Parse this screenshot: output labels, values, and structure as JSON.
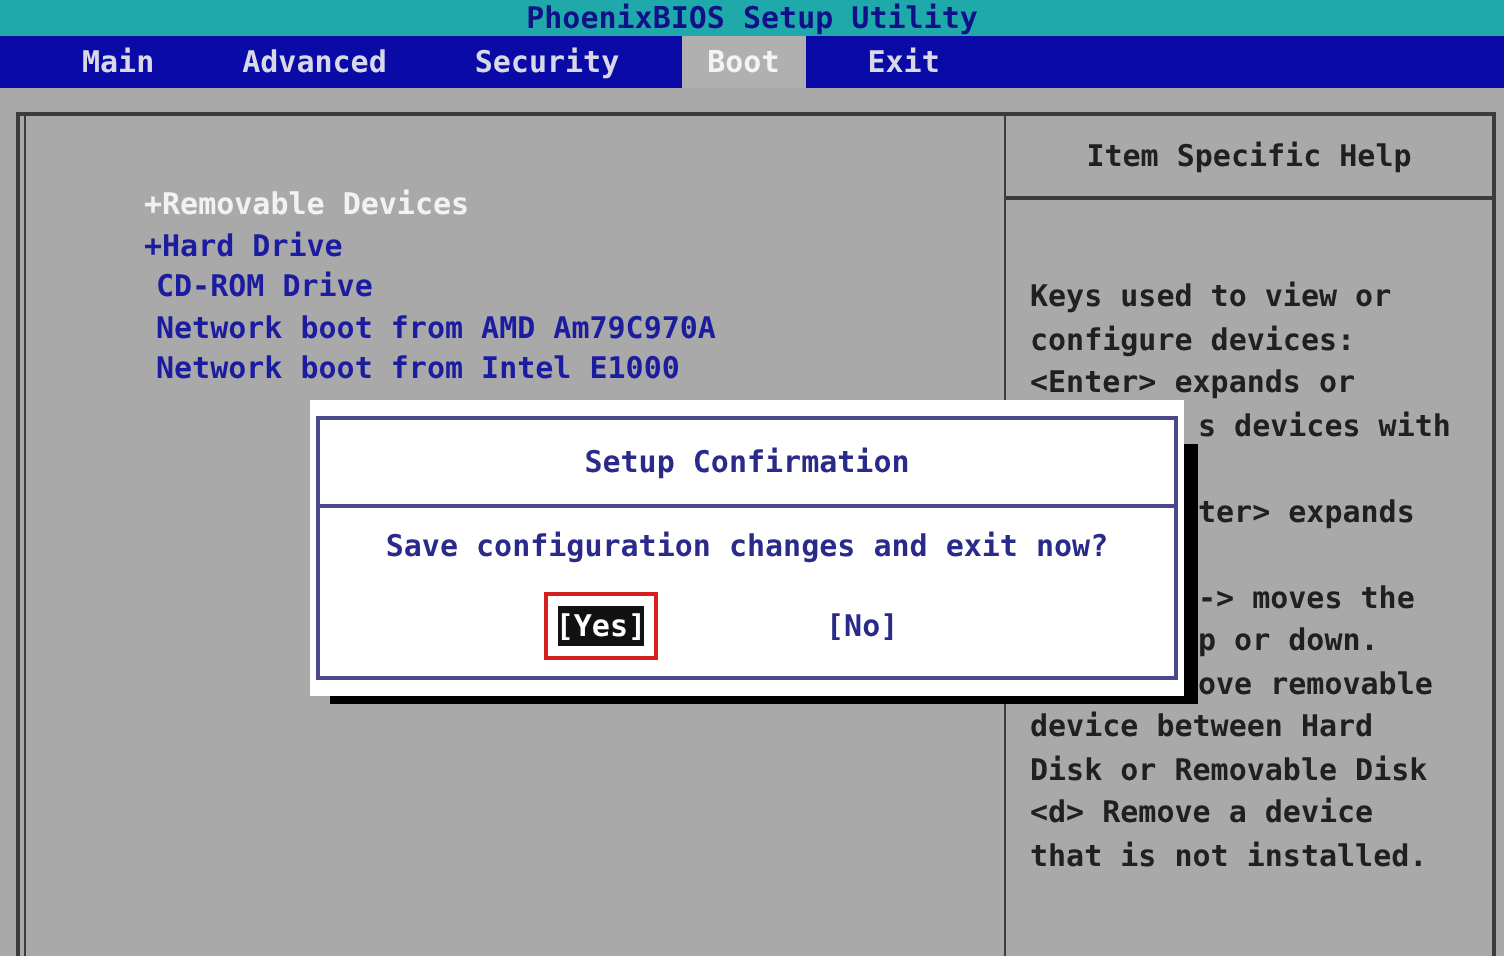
{
  "window": {
    "title": "PhoenixBIOS Setup Utility"
  },
  "tabs": [
    {
      "label": "Main",
      "selected": false
    },
    {
      "label": "Advanced",
      "selected": false
    },
    {
      "label": "Security",
      "selected": false
    },
    {
      "label": "Boot",
      "selected": true
    },
    {
      "label": "Exit",
      "selected": false
    }
  ],
  "boot_items": [
    {
      "label": "+Removable Devices",
      "selected": true
    },
    {
      "label": "+Hard Drive",
      "selected": false
    },
    {
      "label": "CD-ROM Drive",
      "selected": false
    },
    {
      "label": "Network boot from AMD Am79C970A",
      "selected": false
    },
    {
      "label": "Network boot from Intel E1000",
      "selected": false
    }
  ],
  "help": {
    "title": "Item Specific Help",
    "lines": [
      {
        "text": "Keys used to view or",
        "kind": "full"
      },
      {
        "text": "configure devices:",
        "kind": "full"
      },
      {
        "text": "<Enter> expands or",
        "kind": "full"
      },
      {
        "text": "s devices with",
        "kind": "clipped"
      },
      {
        "text": "ter> expands",
        "kind": "clipped-gap"
      },
      {
        "text": "-> moves the",
        "kind": "clipped-gap"
      },
      {
        "text": "p or down.",
        "kind": "clipped"
      },
      {
        "text": "ove removable",
        "kind": "clipped"
      },
      {
        "text": "device between Hard",
        "kind": "full"
      },
      {
        "text": "Disk or Removable Disk",
        "kind": "full"
      },
      {
        "text": "<d> Remove a device",
        "kind": "full"
      },
      {
        "text": "that is not installed.",
        "kind": "full"
      }
    ]
  },
  "dialog": {
    "title": "Setup Confirmation",
    "message": "Save configuration changes and exit now?",
    "buttons": [
      {
        "label": "[Yes]",
        "selected": true
      },
      {
        "label": "[No]",
        "selected": false
      }
    ]
  }
}
